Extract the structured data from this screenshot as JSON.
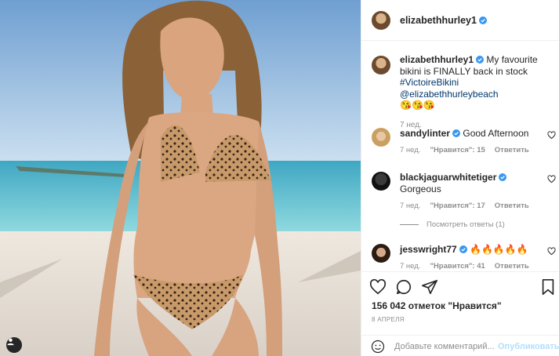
{
  "post": {
    "username": "elizabethhurley1",
    "caption": {
      "text": "My favourite bikini is FINALLY back in stock",
      "hashtag": "#VictoireBikini",
      "mention": "@elizabethhurleybeach",
      "emoji": "😘😘😘",
      "time_ago": "7 нед."
    },
    "comments": [
      {
        "username": "sandylinter",
        "text": "Good Afternoon",
        "time_ago": "7 нед.",
        "likes": "\"Нравится\": 15",
        "reply": "Ответить"
      },
      {
        "username": "blackjaguarwhitetiger",
        "text": "Gorgeous",
        "time_ago": "7 нед.",
        "likes": "\"Нравится\": 17",
        "reply": "Ответить"
      },
      {
        "username": "jesswright77",
        "text": "🔥🔥🔥🔥🔥",
        "time_ago": "7 нед.",
        "likes": "\"Нравится\": 41",
        "reply": "Ответить"
      }
    ],
    "view_replies": "Посмотреть ответы (1)",
    "likes_count": "156 042 отметок \"Нравится\"",
    "date": "8 АПРЕЛЯ",
    "comment_placeholder": "Добавьте комментарий...",
    "publish_label": "Опубликовать"
  },
  "icons": {
    "like": "heart-icon",
    "comment": "comment-icon",
    "share": "paper-plane-icon",
    "save": "bookmark-icon",
    "emoji": "smiley-icon",
    "tag": "user-tag-icon",
    "verified": "verified-badge-icon"
  },
  "colors": {
    "verified": "#3897f0",
    "link": "#00376b",
    "muted": "#8e8e8e",
    "publish": "#b2dffc"
  }
}
